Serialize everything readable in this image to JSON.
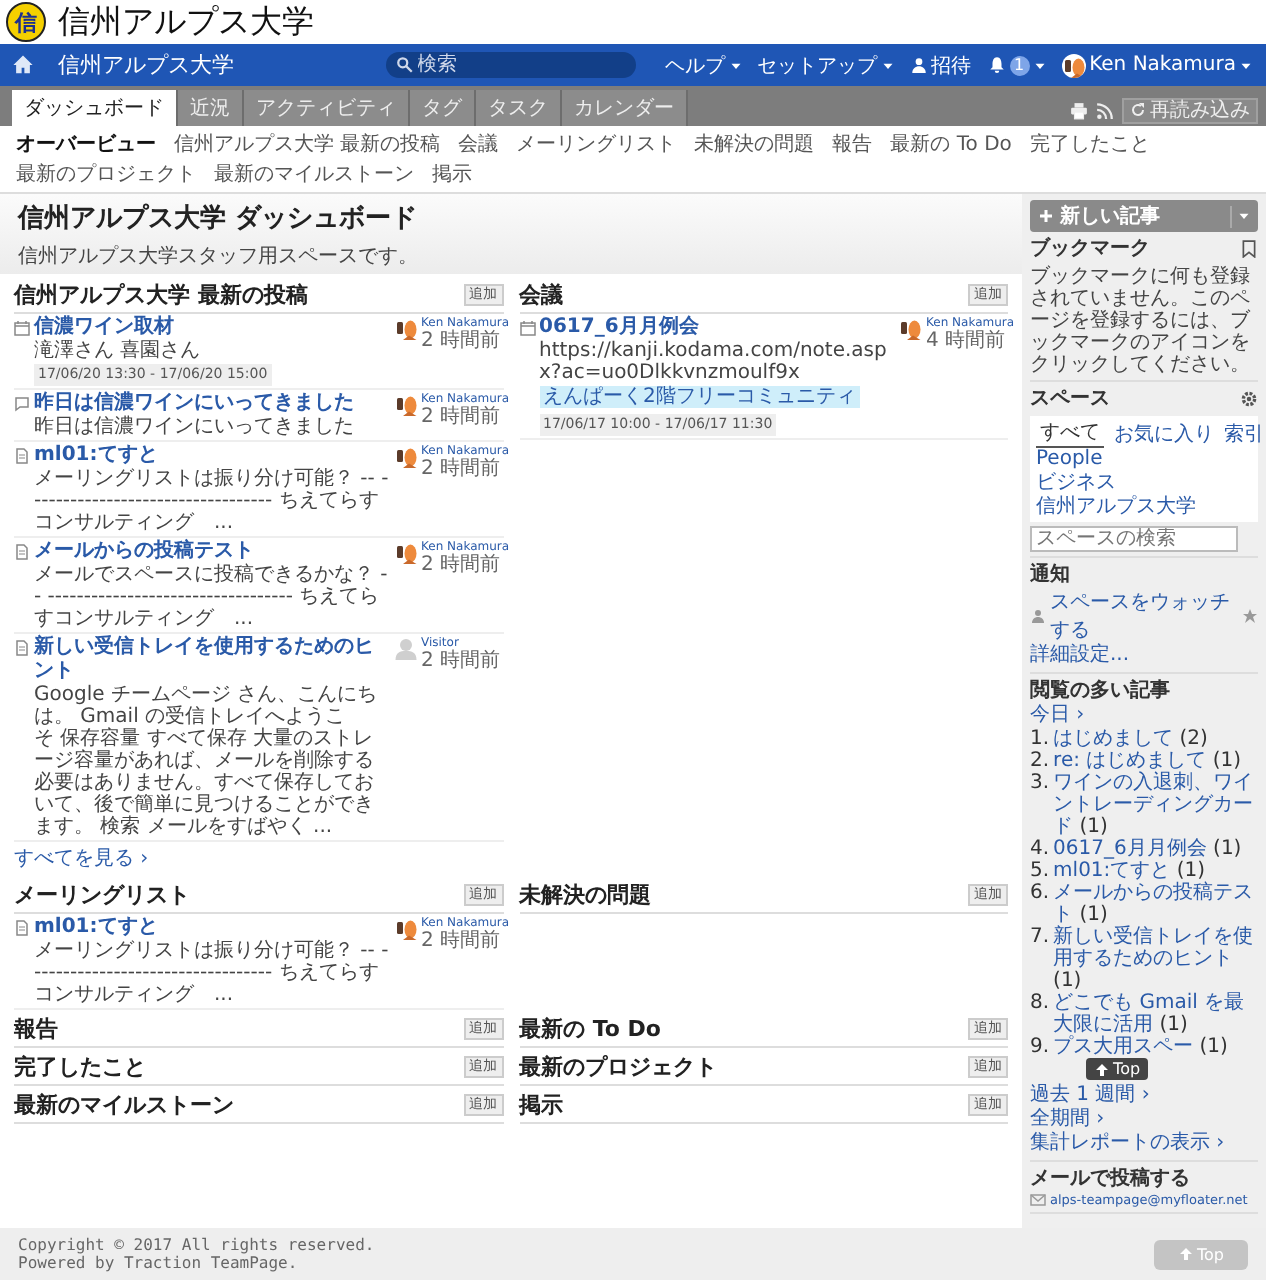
{
  "brand": {
    "logo_char": "信",
    "title": "信州アルプス大学"
  },
  "topbar": {
    "space": "信州アルプス大学",
    "search": {
      "placeholder": "検索"
    },
    "menus": [
      {
        "kind": "menu",
        "label": "ヘルプ"
      },
      {
        "kind": "menu",
        "label": "セットアップ"
      },
      {
        "kind": "invite",
        "label": "招待"
      },
      {
        "kind": "notify",
        "label": "1"
      },
      {
        "kind": "user",
        "label": "Ken Nakamura"
      }
    ]
  },
  "tabs": [
    {
      "label": "ダッシュボード",
      "selected": true
    },
    {
      "label": "近況",
      "selected": false
    },
    {
      "label": "アクティビティ",
      "selected": false
    },
    {
      "label": "タグ",
      "selected": false
    },
    {
      "label": "タスク",
      "selected": false
    },
    {
      "label": "カレンダー",
      "selected": false
    }
  ],
  "reload": "再読み込み",
  "subnav": [
    {
      "label": "オーバービュー",
      "selected": true
    },
    {
      "label": "信州アルプス大学 最新の投稿",
      "selected": false
    },
    {
      "label": "会議",
      "selected": false
    },
    {
      "label": "メーリングリスト",
      "selected": false
    },
    {
      "label": "未解決の問題",
      "selected": false
    },
    {
      "label": "報告",
      "selected": false
    },
    {
      "label": "最新の To Do",
      "selected": false
    },
    {
      "label": "完了したこと",
      "selected": false
    },
    {
      "label": "最新のプロジェクト",
      "selected": false
    },
    {
      "label": "最新のマイルストーン",
      "selected": false
    },
    {
      "label": "掲示",
      "selected": false
    }
  ],
  "page": {
    "title": "信州アルプス大学 ダッシュボード",
    "description": "信州アルプス大学スタッフ用スペースです。",
    "new_button": "新しい記事"
  },
  "sections": [
    {
      "title": "信州アルプス大学 最新の投稿",
      "add": "追加",
      "more": "すべてを見る ›",
      "posts": [
        {
          "kind": "calendar",
          "title": "信濃ワイン取材",
          "body": "滝澤さん 喜園さん",
          "date": "17/06/20 13:30 - 17/06/20 15:00",
          "author": "Ken Nakamura",
          "time": "2 時間前",
          "has_photo": true
        },
        {
          "kind": "comment",
          "title": "昨日は信濃ワインにいってきました",
          "body": "昨日は信濃ワインにいってきました",
          "author": "Ken Nakamura",
          "time": "2 時間前",
          "has_photo": true
        },
        {
          "kind": "document",
          "title": "ml01:てすと",
          "body": "メーリングリストは振り分け可能？ -- ---------------------------------- ちえてらすコンサルティング　...",
          "author": "Ken Nakamura",
          "time": "2 時間前",
          "has_photo": true
        },
        {
          "kind": "document",
          "title": "メールからの投稿テスト",
          "body": "メールでスペースに投稿できるかな？ -- ---------------------------------- ちえてらすコンサルティング　...",
          "author": "Ken Nakamura",
          "time": "2 時間前",
          "has_photo": true
        },
        {
          "kind": "document",
          "title": "新しい受信トレイを使用するためのヒント",
          "body": "Google チームページ さん、こんにちは。 Gmail の受信トレイへようこそ 保存容量 すべて保存 大量のストレージ容量があれば、メールを削除する必要はありません。すべて保存しておいて、後で簡単に見つけることができます。 検索 メールをすばやく ...",
          "author": "Visitor",
          "time": "2 時間前",
          "has_photo": false
        }
      ]
    },
    {
      "title": "会議",
      "add": "追加",
      "posts": [
        {
          "kind": "calendar",
          "title": "0617_6月月例会",
          "body": "https://kanji.kodama.com/note.aspx?ac=uo0Dlkkvnzmoulf9x",
          "tag": "えんぱーく2階フリーコミュニティ",
          "date": "17/06/17 10:00 - 17/06/17 11:30",
          "author": "Ken Nakamura",
          "time": "4 時間前",
          "has_photo": true
        }
      ]
    },
    {
      "title": "メーリングリスト",
      "add": "追加",
      "posts": [
        {
          "kind": "document",
          "title": "ml01:てすと",
          "body": "メーリングリストは振り分け可能？ -- ---------------------------------- ちえてらすコンサルティング　...",
          "author": "Ken Nakamura",
          "time": "2 時間前",
          "has_photo": true
        }
      ]
    },
    {
      "title": "未解決の問題",
      "add": "追加"
    },
    {
      "title": "報告",
      "add": "追加"
    },
    {
      "title": "最新の To Do",
      "add": "追加"
    },
    {
      "title": "完了したこと",
      "add": "追加"
    },
    {
      "title": "最新のプロジェクト",
      "add": "追加"
    },
    {
      "title": "最新のマイルストーン",
      "add": "追加"
    },
    {
      "title": "掲示",
      "add": "追加"
    }
  ],
  "sidebar": {
    "bookmarks": {
      "title": "ブックマーク",
      "text": "ブックマークに何も登録されていません。このページを登録するには、ブックマークのアイコンをクリックしてください。"
    },
    "spaces": {
      "title": "スペース",
      "tabs": [
        {
          "label": "すべて",
          "selected": true
        },
        {
          "label": "お気に入り",
          "selected": false
        }
      ],
      "index": "索引",
      "items": [
        "People",
        "ビジネス",
        "信州アルプス大学"
      ],
      "search": {
        "placeholder": "スペースの検索"
      }
    },
    "notify": {
      "title": "通知",
      "watch": "スペースをウォッチする",
      "settings": "詳細設定..."
    },
    "popular": {
      "title": "閲覧の多い記事",
      "period": "今日 ›",
      "items": [
        {
          "num": "1.",
          "title": "はじめまして",
          "count": "(2)"
        },
        {
          "num": "2.",
          "title": "re: はじめまして",
          "count": "(1)"
        },
        {
          "num": "3.",
          "title": "ワインの入退刺、ワイントレーディングカード",
          "count": "(1)"
        },
        {
          "num": "4.",
          "title": "0617_6月月例会",
          "count": "(1)"
        },
        {
          "num": "5.",
          "title": "ml01:てすと",
          "count": "(1)"
        },
        {
          "num": "6.",
          "title": "メールからの投稿テスト",
          "count": "(1)"
        },
        {
          "num": "7.",
          "title": "新しい受信トレイを使用するためのヒント",
          "count": "(1)"
        },
        {
          "num": "8.",
          "title": "どこでも Gmail を最大限に活用",
          "count": "(1)"
        },
        {
          "num": "9.",
          "title": "プス大用スペー",
          "count": "(1)",
          "overlay": "Top"
        }
      ],
      "links": [
        "過去 1 週間 ›",
        "全期間 ›",
        "集計レポートの表示 ›"
      ]
    },
    "mail": {
      "title": "メールで投稿する",
      "address": "alps-teampage@myfloater.net"
    }
  },
  "footer": {
    "lines": [
      "Copyright © 2017 All rights reserved.",
      "Powered by Traction TeamPage."
    ],
    "top": "Top"
  }
}
